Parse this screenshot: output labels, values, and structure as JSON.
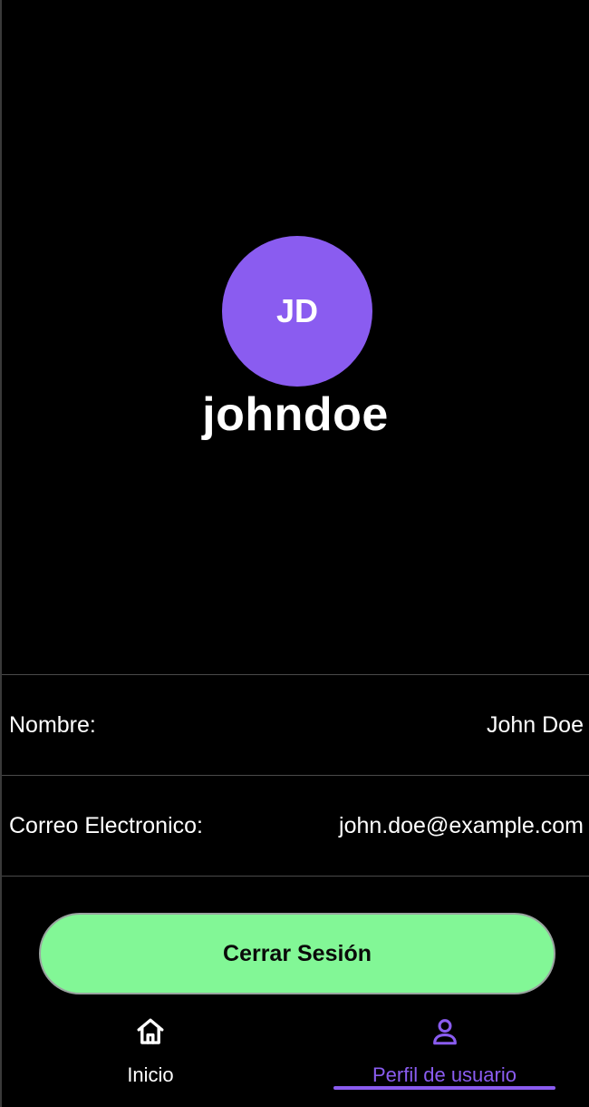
{
  "colors": {
    "accent": "#8a5cf0",
    "button_bg": "#82f796",
    "background": "#000000",
    "text": "#ffffff"
  },
  "profile": {
    "initials": "JD",
    "username": "johndoe"
  },
  "info": {
    "rows": [
      {
        "label": "Nombre:",
        "value": "John Doe"
      },
      {
        "label": "Correo Electronico:",
        "value": "john.doe@example.com"
      }
    ]
  },
  "actions": {
    "logout_label": "Cerrar Sesión"
  },
  "nav": {
    "items": [
      {
        "label": "Inicio",
        "icon": "home-icon",
        "active": false
      },
      {
        "label": "Perfil de usuario",
        "icon": "user-icon",
        "active": true
      }
    ]
  }
}
